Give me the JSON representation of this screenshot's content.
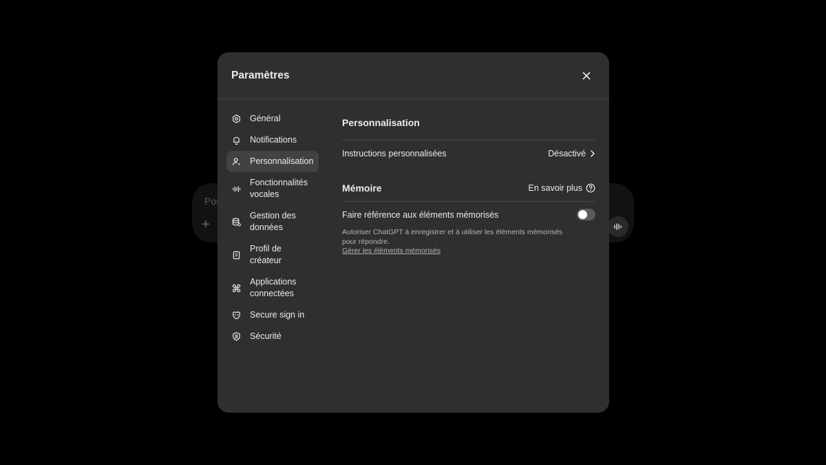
{
  "background": {
    "composer_placeholder": "Pos"
  },
  "modal": {
    "title": "Paramètres"
  },
  "sidebar": {
    "items": [
      {
        "label": "Général",
        "icon": "gear-icon"
      },
      {
        "label": "Notifications",
        "icon": "bell-icon"
      },
      {
        "label": "Personnalisation",
        "icon": "user-sparkle-icon",
        "active": true
      },
      {
        "label": "Fonctionnalités vocales",
        "icon": "waveform-icon"
      },
      {
        "label": "Gestion des données",
        "icon": "database-icon"
      },
      {
        "label": "Profil de créateur",
        "icon": "id-card-icon"
      },
      {
        "label": "Applications connectées",
        "icon": "command-icon"
      },
      {
        "label": "Secure sign in",
        "icon": "key-icon"
      },
      {
        "label": "Sécurité",
        "icon": "shield-user-icon"
      }
    ]
  },
  "content": {
    "personalization_title": "Personnalisation",
    "instructions_label": "Instructions personnalisées",
    "instructions_value": "Désactivé",
    "memory_title": "Mémoire",
    "learn_more": "En savoir plus",
    "reference_label": "Faire référence aux éléments mémorisés",
    "reference_enabled": false,
    "memory_description": "Autoriser ChatGPT à enregistrer et à utiliser les éléments mémorisés pour répondre.",
    "manage_link": "Gérer les éléments mémorisés"
  },
  "colors": {
    "page_bg": "#000000",
    "modal_bg": "#2f2f2f",
    "active_item_bg": "#424242",
    "text": "#ececec",
    "muted_text": "#b4b4b4"
  }
}
